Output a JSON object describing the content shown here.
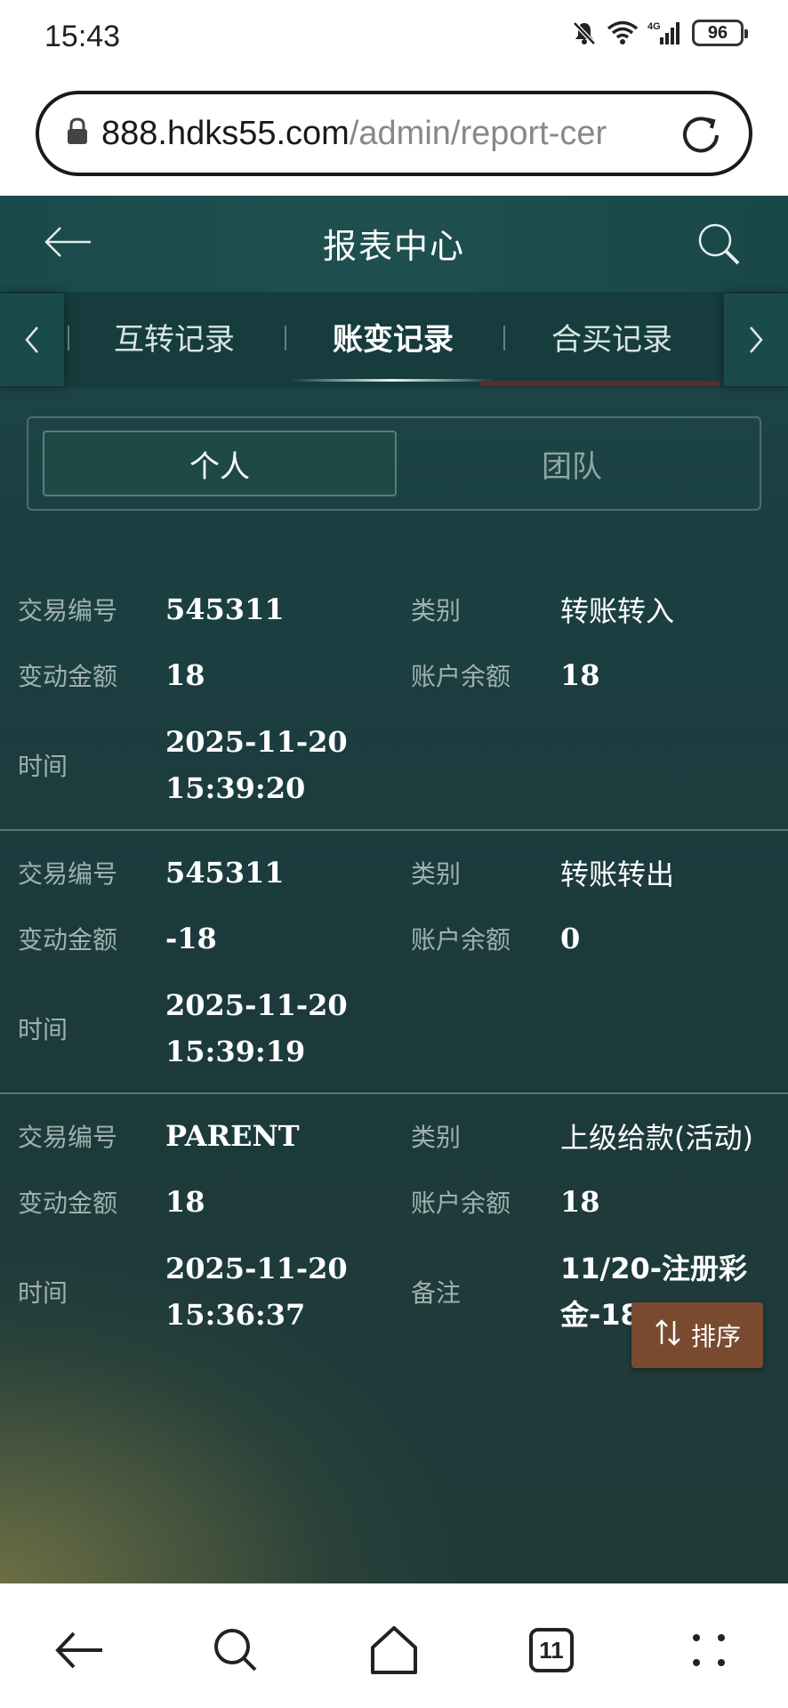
{
  "status_bar": {
    "time": "15:43",
    "battery": "96",
    "network": "4G",
    "icons": [
      "mute-icon",
      "wifi-icon",
      "signal-icon",
      "battery-icon"
    ]
  },
  "browser": {
    "url_host": "888.hdks55.com",
    "url_path": "/admin/report-cer",
    "icons": [
      "lock-icon",
      "reload-icon"
    ]
  },
  "header": {
    "title": "报表中心",
    "icons": [
      "back-arrow-icon",
      "search-icon"
    ]
  },
  "tabs": [
    {
      "label": "互转记录",
      "active": false
    },
    {
      "label": "账变记录",
      "active": true
    },
    {
      "label": "合买记录",
      "active": false
    }
  ],
  "segment": {
    "personal": "个人",
    "team": "团队",
    "selected": "个人"
  },
  "labels": {
    "tx_id": "交易编号",
    "category": "类别",
    "amount": "变动金额",
    "balance": "账户余额",
    "time": "时间",
    "note": "备注"
  },
  "records": [
    {
      "tx_id": "545311",
      "category": "转账转入",
      "amount": "18",
      "balance": "18",
      "time": "2025-11-20\n15:39:20"
    },
    {
      "tx_id": "545311",
      "category": "转账转出",
      "amount": "-18",
      "balance": "0",
      "time": "2025-11-20\n15:39:19"
    },
    {
      "tx_id": "PARENT",
      "category": "上级给款(活动)",
      "amount": "18",
      "balance": "18",
      "time": "2025-11-20\n15:36:37",
      "note": "11/20-注册彩\n金-18"
    }
  ],
  "sort_button": {
    "label": "排序",
    "icon": "sort-arrows-icon"
  },
  "nav": {
    "tab_count": "11",
    "icons": [
      "back-icon",
      "search-icon",
      "home-icon",
      "tabs-icon",
      "menu-icon"
    ]
  },
  "colors": {
    "app_bg": "#1c3a3c",
    "header_bg": "#1f4f4f",
    "sort_button": "#7a4a30",
    "label_text": "#9fb1ae"
  }
}
